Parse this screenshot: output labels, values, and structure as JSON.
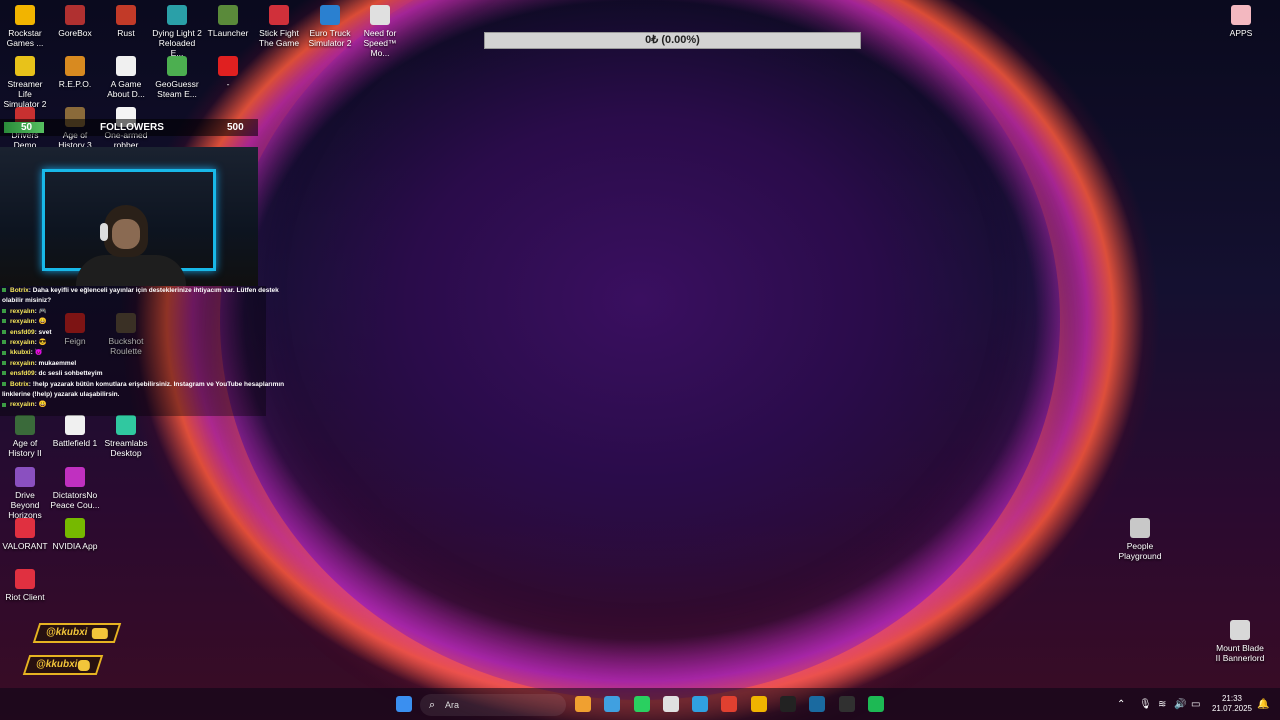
{
  "download": {
    "progress_text": "0₺ (0.00%)",
    "fraction": 0.0
  },
  "followers": {
    "left": "50",
    "label": "FOLLOWERS",
    "right": "500"
  },
  "desktop": {
    "icons": [
      {
        "label": "Rockstar Games ...",
        "icon": "rockstar-icon",
        "color": "#f2b400"
      },
      {
        "label": "GoreBox",
        "icon": "gorebox-icon",
        "color": "#b03030"
      },
      {
        "label": "Rust",
        "icon": "rust-icon",
        "color": "#c23a28"
      },
      {
        "label": "Dying Light 2 Reloaded E...",
        "icon": "dying-light-icon",
        "color": "#2aa0a8"
      },
      {
        "label": "TLauncher",
        "icon": "tlauncher-icon",
        "color": "#5a8a3a"
      },
      {
        "label": "Stick Fight The Game",
        "icon": "stick-fight-icon",
        "color": "#d0303a"
      },
      {
        "label": "Euro Truck Simulator 2",
        "icon": "euro-truck-icon",
        "color": "#2a80d0"
      },
      {
        "label": "Need for Speed™ Mo...",
        "icon": "nfs-icon",
        "color": "#e0e0e0"
      },
      {
        "label": "Streamer Life Simulator 2",
        "icon": "streamer-life-icon",
        "color": "#e8c21a"
      },
      {
        "label": "R.E.P.O.",
        "icon": "repo-icon",
        "color": "#d88a20"
      },
      {
        "label": "A Game About D...",
        "icon": "a-game-about-icon",
        "color": "#f0f0f0"
      },
      {
        "label": "GeoGuessr Steam E...",
        "icon": "geoguessr-icon",
        "color": "#4caf50"
      },
      {
        "label": "-",
        "icon": "red-dash-icon",
        "color": "#e02020"
      },
      {
        "label": "Drivers Demo",
        "icon": "drivers-demo-icon",
        "color": "#c83030"
      },
      {
        "label": "Age of History 3",
        "icon": "age-of-history-3-icon",
        "color": "#8a6a3a"
      },
      {
        "label": "One-armed robber",
        "icon": "one-armed-robber-icon",
        "color": "#f5f5f5"
      },
      {
        "label": "Feign",
        "icon": "feign-icon",
        "color": "#c02020"
      },
      {
        "label": "Buckshot Roulette",
        "icon": "buckshot-roulette-icon",
        "color": "#5a4a3a"
      },
      {
        "label": "Age of History II",
        "icon": "age-of-history-2-icon",
        "color": "#3a6a3a"
      },
      {
        "label": "Battlefield 1",
        "icon": "battlefield-1-icon",
        "color": "#f0f0f0"
      },
      {
        "label": "Streamlabs Desktop",
        "icon": "streamlabs-icon",
        "color": "#30c8a0"
      },
      {
        "label": "Drive Beyond Horizons",
        "icon": "drive-beyond-icon",
        "color": "#8a50c0"
      },
      {
        "label": "DictatorsNo Peace Cou...",
        "icon": "dictators-icon",
        "color": "#c030c0"
      },
      {
        "label": "VALORANT",
        "icon": "valorant-icon",
        "color": "#e03040"
      },
      {
        "label": "NVIDIA App",
        "icon": "nvidia-icon",
        "color": "#76b900"
      },
      {
        "label": "Riot Client",
        "icon": "riot-client-icon",
        "color": "#e03040"
      },
      {
        "label": "APPS",
        "icon": "folder-icon",
        "color": "#f3b8c0"
      },
      {
        "label": "People Playground",
        "icon": "people-playground-icon",
        "color": "#c8c8c8"
      },
      {
        "label": "Mount  Blade II Bannerlord",
        "icon": "bannerlord-icon",
        "color": "#d8d8d8"
      }
    ]
  },
  "chat": {
    "lines": [
      {
        "user": "Botrix",
        "text": ": Daha keyifli ve eğlenceli yayınlar için desteklerinize ihtiyacım var. Lütfen destek"
      },
      {
        "user": "",
        "text": "olabilir misiniz?"
      },
      {
        "user": "rexyalın",
        "text": ": 🎮"
      },
      {
        "user": "rexyalın",
        "text": ": 😄"
      },
      {
        "user": "ensfd09",
        "text": ": svet"
      },
      {
        "user": "rexyalın",
        "text": ": 😎"
      },
      {
        "user": "kkubxi",
        "text": ": 😈"
      },
      {
        "user": "rexyalın",
        "text": ": mukaemmel"
      },
      {
        "user": "ensfd09",
        "text": ": dc sesli sohbetteyim"
      },
      {
        "user": "Botrix",
        "text": ": !help yazarak bütün komutlara erişebilirsiniz. Instagram ve YouTube hesaplarımın"
      },
      {
        "user": "",
        "text": "linklerine (!help) yazarak ulaşabilirsin."
      },
      {
        "user": "rexyalın",
        "text": ": 😀"
      }
    ]
  },
  "socials": [
    {
      "handle": "@kkubxi",
      "icon": "youtube-icon",
      "color": "#e6b322"
    },
    {
      "handle": "@kkubxi",
      "icon": "instagram-icon",
      "color": "#e6b322"
    }
  ],
  "taskbar": {
    "search_placeholder": "Ara",
    "apps": [
      "windows-start-icon",
      "widgets-icon",
      "copilot-icon",
      "file-explorer-icon",
      "whatsapp-icon",
      "chrome-icon",
      "microsoft-store-icon",
      "ea-icon",
      "rockstar-icon",
      "epic-games-icon",
      "steam-icon",
      "obs-icon",
      "spotify-icon"
    ],
    "time": "21:33",
    "date": "21.07.2025"
  }
}
